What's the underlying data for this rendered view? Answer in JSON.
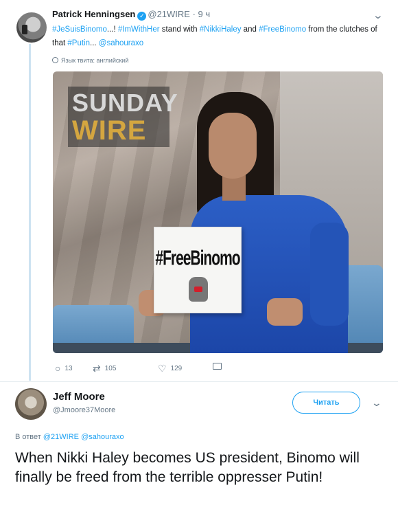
{
  "tweet1": {
    "author_name": "Patrick Henningsen",
    "handle": "@21WIRE",
    "time": "· 9 ч",
    "text_parts": [
      {
        "text": "#JeSuisBinomo",
        "link": true
      },
      {
        "text": "...! ",
        "link": false
      },
      {
        "text": "#ImWithHer",
        "link": true
      },
      {
        "text": " stand with ",
        "link": false
      },
      {
        "text": "#NikkiHaley",
        "link": true
      },
      {
        "text": " and ",
        "link": false
      },
      {
        "text": "#FreeBinomo",
        "link": true
      },
      {
        "text": " from the clutches of that ",
        "link": false
      },
      {
        "text": "#Putin",
        "link": true
      },
      {
        "text": "... ",
        "link": false
      },
      {
        "text": "@sahouraxo",
        "link": true
      }
    ],
    "translate_label": "Язык твита: английский",
    "image": {
      "logo_line1": "SUNDAY",
      "logo_line2": "WIRE",
      "sign_text": "#FreeBinomo"
    },
    "actions": {
      "replies": "13",
      "retweets": "105",
      "likes": "129"
    }
  },
  "tweet2": {
    "author_name": "Jeff Moore",
    "handle": "@Jmoore37Moore",
    "follow_label": "Читать",
    "reply_prefix": "В ответ",
    "reply_to_1": "@21WIRE",
    "reply_to_2": "@sahouraxo",
    "text": "When Nikki Haley becomes US president, Binomo will finally be freed from the terrible oppresser Putin!"
  },
  "colors": {
    "link": "#1da1f2",
    "muted": "#657786",
    "text": "#14171a"
  },
  "icons": [
    "verified-badge-icon",
    "chevron-down-icon",
    "globe-icon",
    "reply-icon",
    "retweet-icon",
    "like-icon",
    "direct-message-icon"
  ]
}
